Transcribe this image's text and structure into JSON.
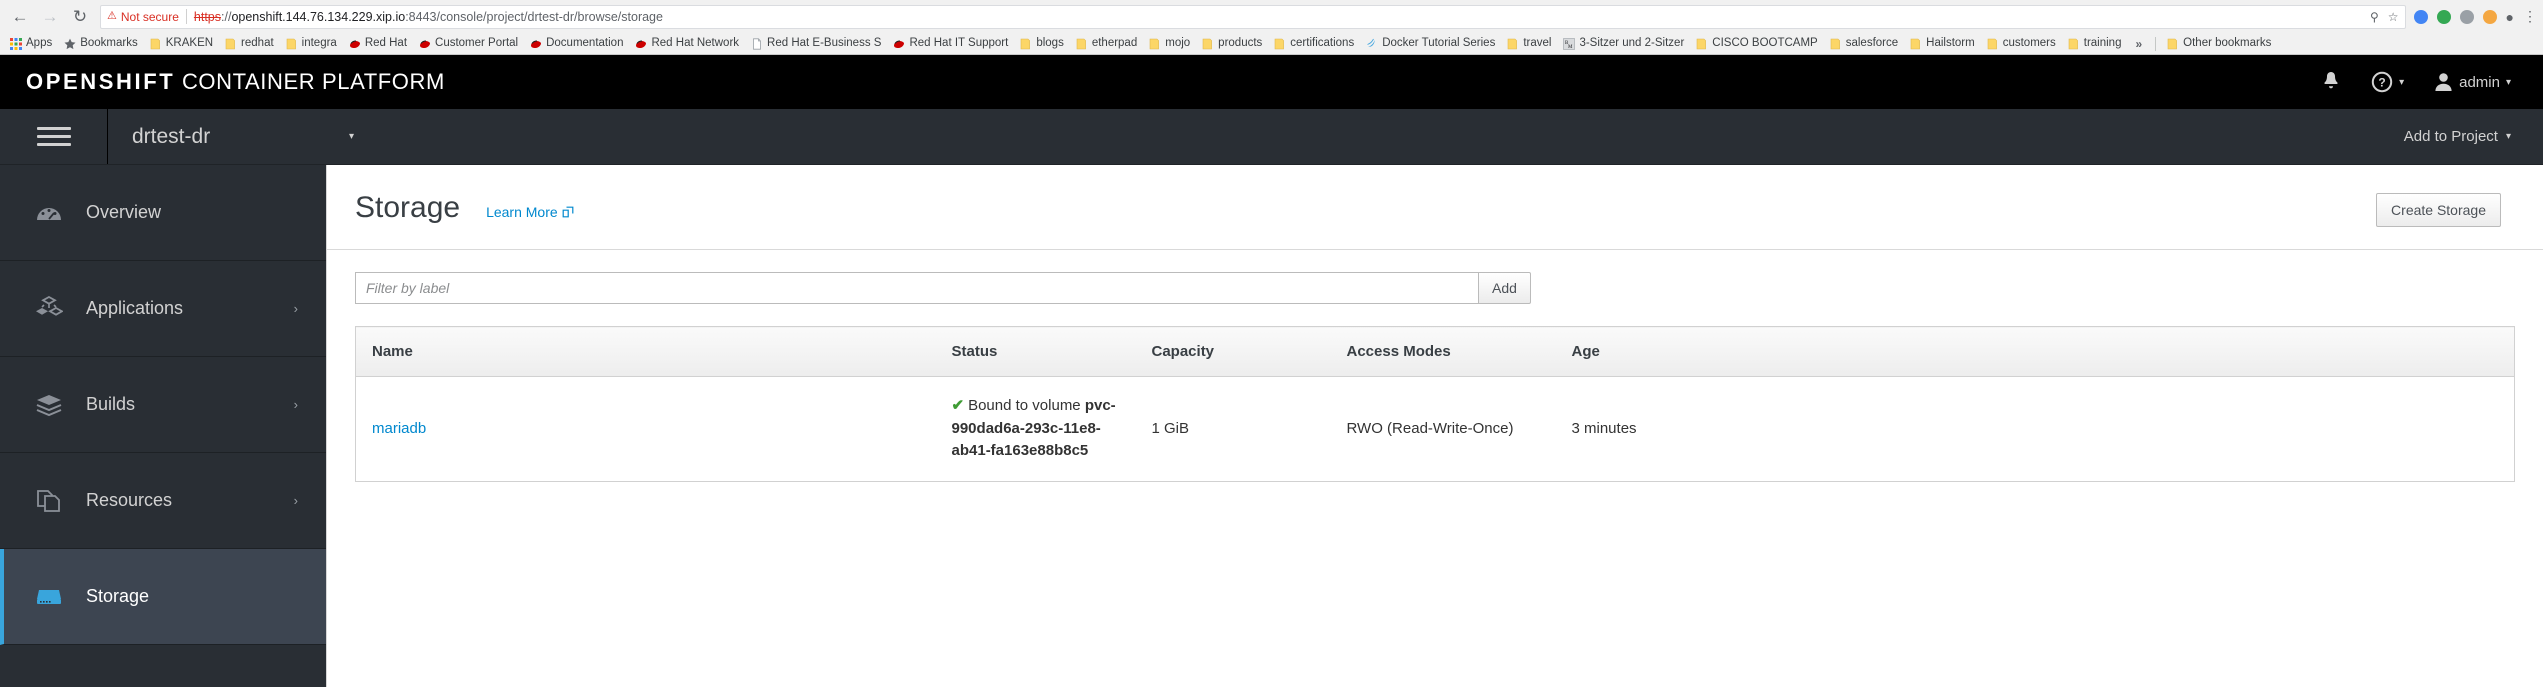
{
  "browser": {
    "nav": {
      "back_icon": "arrow-left-icon",
      "forward_icon": "arrow-right-icon",
      "reload_icon": "reload-icon"
    },
    "security_label": "Not secure",
    "warning_icon": "warning-triangle-icon",
    "url": {
      "scheme": "https",
      "separator": "://",
      "host": "openshift.144.76.134.229.xip.io",
      "rest": ":8443/console/project/drtest-dr/browse/storage",
      "full": "https://openshift.144.76.134.229.xip.io:8443/console/project/drtest-dr/browse/storage"
    },
    "url_icons": [
      "zoom-icon",
      "star-icon"
    ],
    "bookmarks": [
      {
        "label": "Apps",
        "icon": "apps-grid-icon"
      },
      {
        "label": "Bookmarks",
        "icon": "star-icon"
      },
      {
        "label": "KRAKEN",
        "icon": "folder-icon"
      },
      {
        "label": "redhat",
        "icon": "folder-icon"
      },
      {
        "label": "integra",
        "icon": "folder-icon"
      },
      {
        "label": "Red Hat",
        "icon": "redhat-icon"
      },
      {
        "label": "Customer Portal",
        "icon": "redhat-icon"
      },
      {
        "label": "Documentation",
        "icon": "redhat-icon"
      },
      {
        "label": "Red Hat Network",
        "icon": "redhat-icon"
      },
      {
        "label": "Red Hat E-Business S",
        "icon": "page-icon"
      },
      {
        "label": "Red Hat IT Support",
        "icon": "redhat-icon"
      },
      {
        "label": "blogs",
        "icon": "folder-icon"
      },
      {
        "label": "etherpad",
        "icon": "folder-icon"
      },
      {
        "label": "mojo",
        "icon": "folder-icon"
      },
      {
        "label": "products",
        "icon": "folder-icon"
      },
      {
        "label": "certifications",
        "icon": "folder-icon"
      },
      {
        "label": "Docker Tutorial Series",
        "icon": "docker-swirl-icon"
      },
      {
        "label": "travel",
        "icon": "folder-icon"
      },
      {
        "label": "3-Sitzer und 2-Sitzer",
        "icon": "bm-letter-icon"
      },
      {
        "label": "CISCO BOOTCAMP",
        "icon": "folder-icon"
      },
      {
        "label": "salesforce",
        "icon": "folder-icon"
      },
      {
        "label": "Hailstorm",
        "icon": "folder-icon"
      },
      {
        "label": "customers",
        "icon": "folder-icon"
      },
      {
        "label": "training",
        "icon": "folder-icon"
      }
    ],
    "overflow_label": "»",
    "other_bookmarks": {
      "label": "Other bookmarks",
      "icon": "folder-icon"
    }
  },
  "masthead": {
    "brand_bold": "OPENSHIFT",
    "brand_light": "CONTAINER PLATFORM",
    "notifications_icon": "bell-icon",
    "help_icon": "question-circle-icon",
    "user_icon": "user-avatar-icon",
    "user_label": "admin",
    "caret_icon": "chevron-down-icon",
    "bg_color": "#000000"
  },
  "projectbar": {
    "menu_icon": "hamburger-menu-icon",
    "project_name": "drtest-dr",
    "project_caret_icon": "chevron-down-icon",
    "add_to_project_label": "Add to Project",
    "add_to_project_caret_icon": "chevron-down-icon",
    "bg_color": "#292e34"
  },
  "sidebar": {
    "items": [
      {
        "label": "Overview",
        "icon": "gauge-icon",
        "has_caret": false,
        "active": false
      },
      {
        "label": "Applications",
        "icon": "cubes-icon",
        "has_caret": true,
        "active": false
      },
      {
        "label": "Builds",
        "icon": "layers-icon",
        "has_caret": true,
        "active": false
      },
      {
        "label": "Resources",
        "icon": "documents-icon",
        "has_caret": true,
        "active": false
      },
      {
        "label": "Storage",
        "icon": "database-icon",
        "has_caret": false,
        "active": true
      }
    ],
    "active_accent_color": "#39a5dc"
  },
  "main": {
    "page_title": "Storage",
    "learn_more_label": "Learn More",
    "learn_more_icon": "external-link-icon",
    "create_storage_label": "Create Storage",
    "filter": {
      "placeholder": "Filter by label",
      "value": "",
      "add_label": "Add"
    },
    "table": {
      "columns": [
        "Name",
        "Status",
        "Capacity",
        "Access Modes",
        "Age"
      ],
      "rows": [
        {
          "name": "mariadb",
          "status_icon": "check-icon",
          "status_prefix": "Bound to volume ",
          "status_volume": "pvc-990dad6a-293c-11e8-ab41-fa163e88b8c5",
          "capacity": "1 GiB",
          "access_modes": "RWO (Read-Write-Once)",
          "age": "3 minutes"
        }
      ]
    },
    "link_color": "#0088ce",
    "success_color": "#3f9c35"
  }
}
